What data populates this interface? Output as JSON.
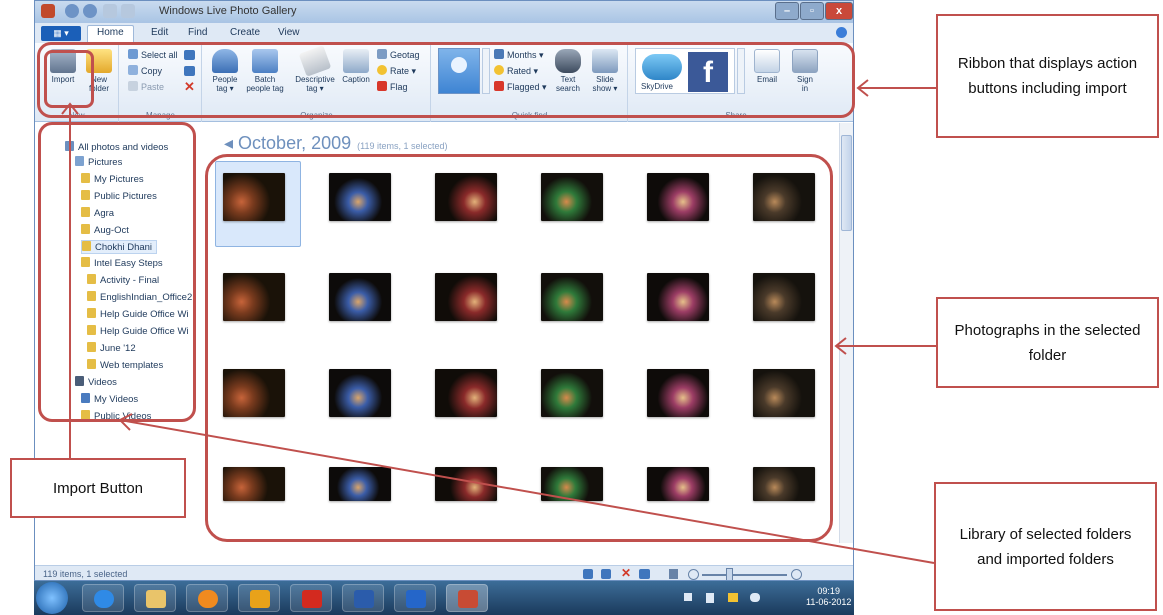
{
  "window": {
    "title": "Windows Live Photo Gallery",
    "controls": {
      "minimize": "–",
      "maximize": "▫",
      "close": "x"
    }
  },
  "tabs": [
    "Home",
    "Edit",
    "Find",
    "Create",
    "View"
  ],
  "ribbon": {
    "new_group": {
      "import": "Import",
      "new_folder_1": "New",
      "new_folder_2": "folder",
      "label": "New"
    },
    "manage": {
      "select_all": "Select all",
      "copy": "Copy",
      "paste": "Paste",
      "label": "Manage"
    },
    "organize": {
      "people_tag_1": "People",
      "people_tag_2": "tag ▾",
      "batch_1": "Batch",
      "batch_2": "people tag",
      "descriptive_1": "Descriptive",
      "descriptive_2": "tag ▾",
      "caption": "Caption",
      "geotag": "Geotag",
      "rate": "Rate ▾",
      "flag": "Flag",
      "label": "Organize"
    },
    "quick_find": {
      "months": "Months ▾",
      "rated": "Rated ▾",
      "flagged": "Flagged ▾",
      "text_1": "Text",
      "text_2": "search",
      "slide_1": "Slide",
      "slide_2": "show ▾",
      "label": "Quick find"
    },
    "share": {
      "skydrive": "SkyDrive",
      "email": "Email",
      "sign_1": "Sign",
      "sign_2": "in",
      "label": "Share"
    }
  },
  "nav": {
    "all": "All photos and videos",
    "pictures": "Pictures",
    "folders": [
      "My Pictures",
      "Public Pictures",
      "Agra",
      "Aug-Oct",
      "Chokhi Dhani",
      "Intel Easy Steps"
    ],
    "subfolders": [
      "Activity - Final",
      "EnglishIndian_Office2",
      "Help Guide Office Wi",
      "Help Guide Office Wi",
      "June '12",
      "Web templates"
    ],
    "videos": "Videos",
    "video_folders": [
      "My Videos",
      "Public Videos"
    ]
  },
  "content": {
    "heading": "October, 2009",
    "sub": "(119 items, 1 selected)"
  },
  "status": {
    "text": "119 items, 1 selected"
  },
  "clock": {
    "time": "09:19",
    "date": "11-06-2012"
  },
  "callouts": {
    "ribbon": "Ribbon that displays action buttons including import",
    "photos": "Photographs in the selected folder",
    "import": "Import Button",
    "library": "Library of selected folders and imported folders"
  },
  "colors": {
    "accent": "#c0504d",
    "ribbon": "#dfe9f5",
    "taskbar": "#1b3a5c"
  }
}
